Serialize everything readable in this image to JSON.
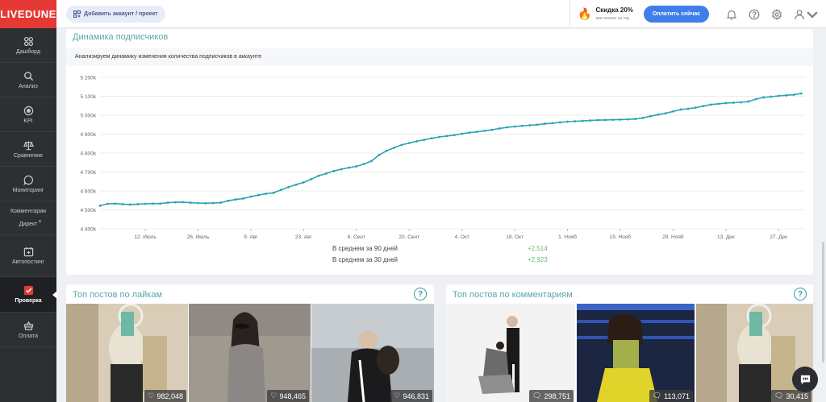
{
  "brand": {
    "logo": "LIVEDUNE"
  },
  "sidebar": {
    "items": [
      {
        "label": "Дашборд",
        "icon": "dashboard-icon"
      },
      {
        "label": "Анализ",
        "icon": "search-icon"
      },
      {
        "label": "KPI",
        "icon": "target-icon"
      },
      {
        "label": "Сравнение",
        "icon": "scales-icon"
      },
      {
        "label": "Мониторинг",
        "icon": "chat-icon"
      },
      {
        "label": "Комментарии",
        "icon": ""
      },
      {
        "label": "Директ",
        "icon": ""
      },
      {
        "label": "Автопостинг",
        "icon": "calendar-icon"
      },
      {
        "label": "Проверка",
        "icon": "check-icon"
      },
      {
        "label": "Оплата",
        "icon": "basket-icon"
      }
    ]
  },
  "topbar": {
    "add_account": "Добавить аккаунт / проект",
    "promo_title": "Скидка 20%",
    "promo_sub": "при оплате на год",
    "pay_button": "Оплатить сейчас"
  },
  "chart_section": {
    "title": "Динамика подписчиков",
    "subtitle": "Анализируем динамику изменения количества подписчиков в аккаунте"
  },
  "chart_data": {
    "type": "line",
    "title": "",
    "y_ticks": [
      "4 400k",
      "4 500k",
      "4 600k",
      "4 700k",
      "4 800k",
      "4 900k",
      "5 000k",
      "5 100k",
      "5 200k"
    ],
    "x_ticks": [
      "12. Июль",
      "26. Июль",
      "9. Авг",
      "23. Авг",
      "6. Сент",
      "20. Сент",
      "4. Окт",
      "18. Окт",
      "1. Нояб",
      "15. Нояб",
      "29. Нояб",
      "13. Дек",
      "27. Дек"
    ],
    "ylim": [
      4400,
      5200
    ],
    "x_range_days": [
      0,
      187
    ],
    "tick_days": [
      12,
      26,
      40,
      54,
      68,
      82,
      96,
      110,
      124,
      138,
      152,
      166,
      180
    ],
    "grid": true,
    "color": "#2aa3b3",
    "series": [
      {
        "name": "",
        "points": [
          [
            0,
            4522
          ],
          [
            2,
            4532
          ],
          [
            4,
            4533
          ],
          [
            6,
            4530
          ],
          [
            8,
            4528
          ],
          [
            10,
            4530
          ],
          [
            12,
            4532
          ],
          [
            14,
            4533
          ],
          [
            16,
            4533
          ],
          [
            18,
            4538
          ],
          [
            20,
            4540
          ],
          [
            22,
            4541
          ],
          [
            24,
            4538
          ],
          [
            26,
            4536
          ],
          [
            28,
            4535
          ],
          [
            30,
            4536
          ],
          [
            32,
            4538
          ],
          [
            34,
            4548
          ],
          [
            36,
            4555
          ],
          [
            38,
            4560
          ],
          [
            40,
            4570
          ],
          [
            42,
            4578
          ],
          [
            44,
            4585
          ],
          [
            46,
            4590
          ],
          [
            48,
            4605
          ],
          [
            50,
            4620
          ],
          [
            52,
            4633
          ],
          [
            54,
            4645
          ],
          [
            56,
            4662
          ],
          [
            58,
            4680
          ],
          [
            60,
            4692
          ],
          [
            62,
            4705
          ],
          [
            64,
            4715
          ],
          [
            66,
            4723
          ],
          [
            68,
            4730
          ],
          [
            70,
            4742
          ],
          [
            72,
            4758
          ],
          [
            74,
            4790
          ],
          [
            76,
            4812
          ],
          [
            78,
            4828
          ],
          [
            80,
            4843
          ],
          [
            82,
            4853
          ],
          [
            84,
            4862
          ],
          [
            86,
            4870
          ],
          [
            88,
            4878
          ],
          [
            90,
            4885
          ],
          [
            92,
            4890
          ],
          [
            94,
            4895
          ],
          [
            96,
            4902
          ],
          [
            98,
            4908
          ],
          [
            100,
            4912
          ],
          [
            102,
            4918
          ],
          [
            104,
            4923
          ],
          [
            106,
            4930
          ],
          [
            108,
            4936
          ],
          [
            110,
            4940
          ],
          [
            112,
            4944
          ],
          [
            114,
            4947
          ],
          [
            116,
            4950
          ],
          [
            118,
            4955
          ],
          [
            120,
            4958
          ],
          [
            122,
            4962
          ],
          [
            124,
            4966
          ],
          [
            126,
            4968
          ],
          [
            128,
            4970
          ],
          [
            130,
            4972
          ],
          [
            132,
            4974
          ],
          [
            134,
            4975
          ],
          [
            136,
            4976
          ],
          [
            138,
            4977
          ],
          [
            140,
            4978
          ],
          [
            142,
            4980
          ],
          [
            144,
            4986
          ],
          [
            146,
            4995
          ],
          [
            148,
            5003
          ],
          [
            150,
            5010
          ],
          [
            152,
            5020
          ],
          [
            154,
            5030
          ],
          [
            156,
            5034
          ],
          [
            158,
            5040
          ],
          [
            160,
            5048
          ],
          [
            162,
            5056
          ],
          [
            164,
            5060
          ],
          [
            166,
            5064
          ],
          [
            168,
            5066
          ],
          [
            170,
            5068
          ],
          [
            172,
            5072
          ],
          [
            174,
            5085
          ],
          [
            176,
            5094
          ],
          [
            178,
            5098
          ],
          [
            180,
            5102
          ],
          [
            182,
            5105
          ],
          [
            184,
            5108
          ],
          [
            186,
            5115
          ]
        ]
      }
    ]
  },
  "stats": [
    {
      "label": "В среднем за 90 дней",
      "value": "+2,514"
    },
    {
      "label": "В среднем за 30 дней",
      "value": "+2,923"
    }
  ],
  "top_likes": {
    "title": "Топ постов по лайкам",
    "help": "?",
    "posts": [
      {
        "count": "982,048",
        "icon": "heart-icon",
        "bg": "#c9b8a0"
      },
      {
        "count": "948,465",
        "icon": "heart-icon",
        "bg": "#a09a92"
      },
      {
        "count": "946,831",
        "icon": "heart-icon",
        "bg": "#b3b8bc"
      }
    ]
  },
  "top_comments": {
    "title": "Топ постов по комментариям",
    "help": "?",
    "posts": [
      {
        "count": "298,751",
        "icon": "comment-icon",
        "bg": "#f2f2f2"
      },
      {
        "count": "113,071",
        "icon": "comment-icon",
        "bg": "#1b2740"
      },
      {
        "count": "30,415",
        "icon": "comment-icon",
        "bg": "#c9b8a0"
      }
    ]
  }
}
